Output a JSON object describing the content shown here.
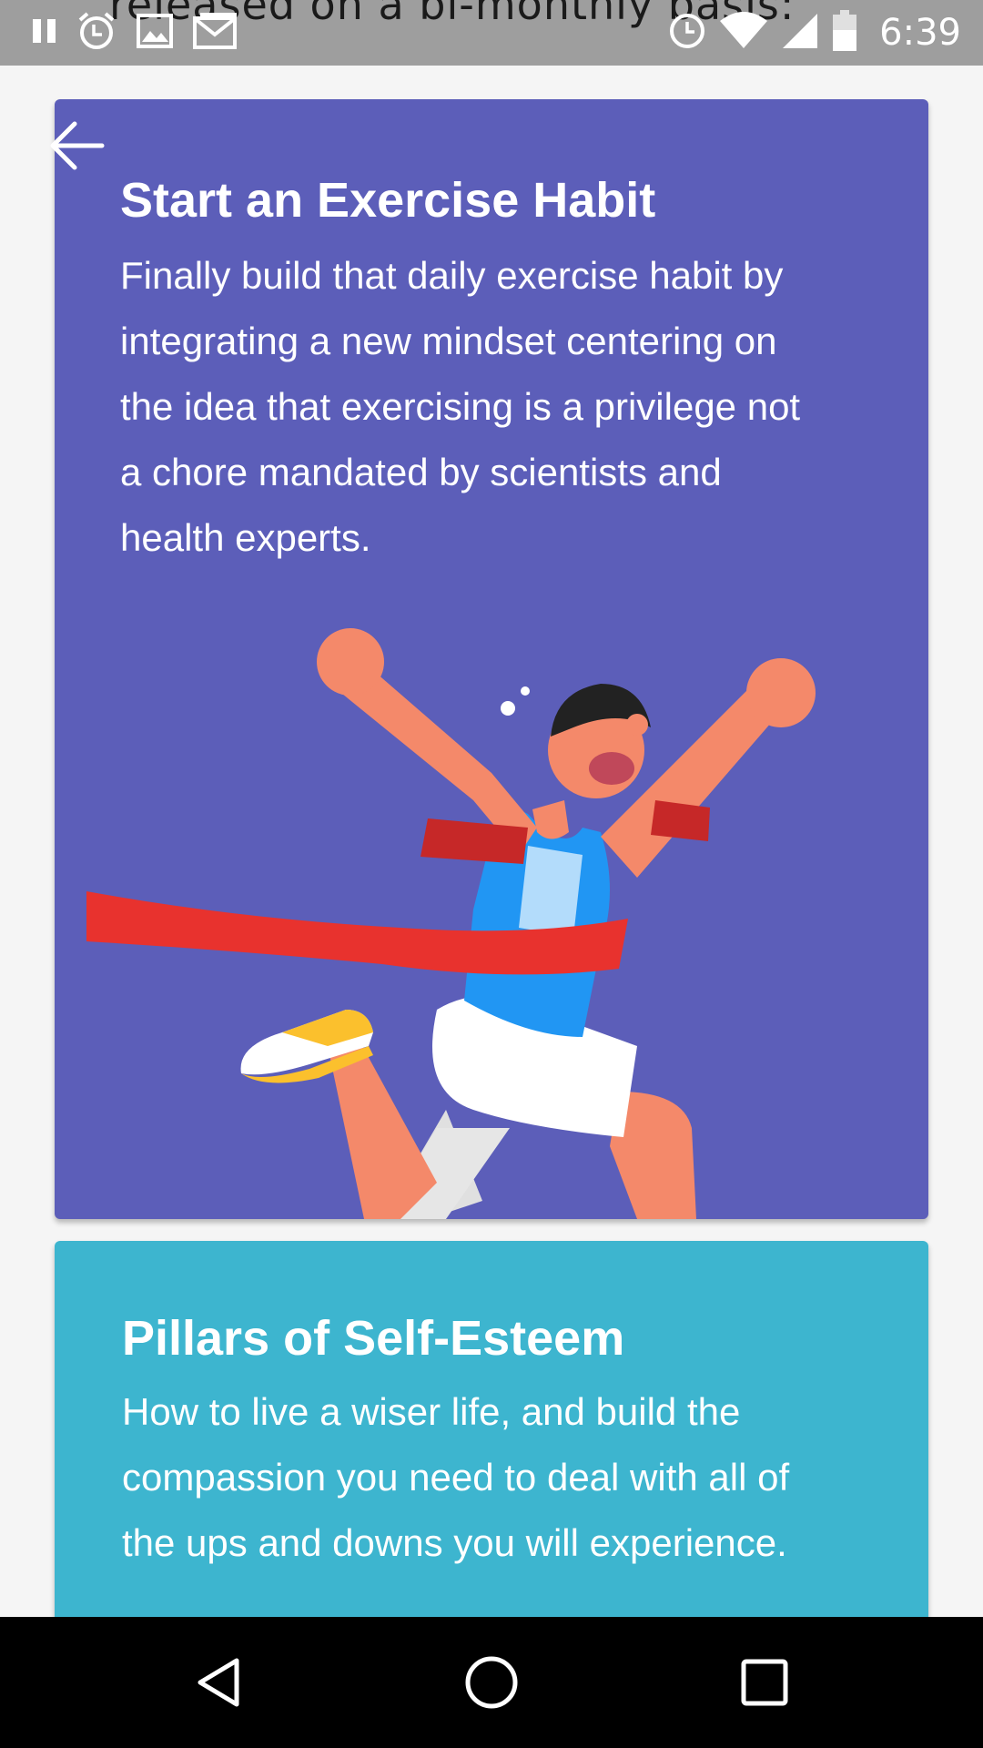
{
  "status_bar": {
    "behind_text": "released on a bi-monthly basis:",
    "time": "6:39",
    "left_icons": [
      "pause-icon",
      "alarm-icon",
      "image-icon",
      "mail-icon"
    ],
    "right_icons": [
      "alarm-icon",
      "wifi-icon",
      "signal-icon",
      "battery-icon"
    ]
  },
  "toolbar": {
    "back_icon": "arrow-left-icon"
  },
  "cards": [
    {
      "title": "Start an Exercise Habit",
      "description": "Finally build that daily exercise habit by integrating a new mindset centering on the idea that exercising is a privilege not a chore mandated by scientists and health experts.",
      "background": "#5c5eb9",
      "illustration": "runner-finish-line"
    },
    {
      "title": "Pillars of Self-Esteem",
      "description": "How to live a wiser life, and build the compassion you need to deal with all of the ups and downs you will experience.",
      "background": "#3db5cf"
    }
  ],
  "nav_bar": {
    "icons": [
      "nav-back-icon",
      "nav-home-icon",
      "nav-recents-icon"
    ]
  },
  "colors": {
    "status_bar": "#9e9e9e",
    "page_background": "#f5f5f5",
    "nav_bar": "#000000",
    "skin": "#f4896a",
    "ribbon": "#e8322e",
    "shirt": "#2196f3",
    "shoe": "#fbc02d"
  }
}
